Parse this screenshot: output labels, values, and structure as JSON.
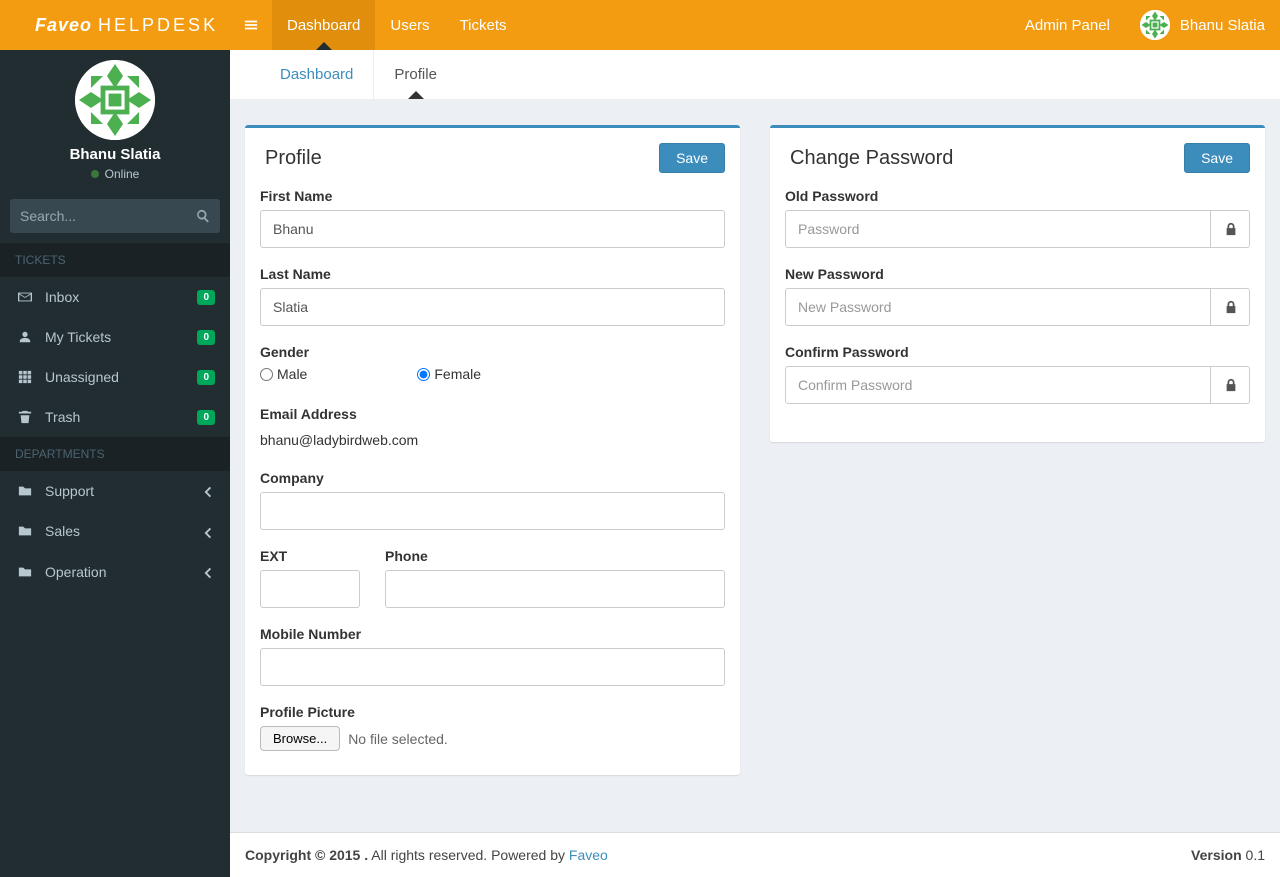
{
  "navbar": {
    "logo_strong": "Faveo",
    "logo_light": "HELPDESK",
    "tabs": [
      {
        "label": "Dashboard",
        "active": true
      },
      {
        "label": "Users",
        "active": false
      },
      {
        "label": "Tickets",
        "active": false
      }
    ],
    "admin_link": "Admin Panel",
    "user_name": "Bhanu Slatia"
  },
  "sidebar": {
    "user": {
      "name": "Bhanu Slatia",
      "status": "Online"
    },
    "search_placeholder": "Search...",
    "section_tickets": "TICKETS",
    "section_departments": "DEPARTMENTS",
    "tickets": [
      {
        "label": "Inbox",
        "badge": "0",
        "icon": "envelope"
      },
      {
        "label": "My Tickets",
        "badge": "0",
        "icon": "user"
      },
      {
        "label": "Unassigned",
        "badge": "0",
        "icon": "grid"
      },
      {
        "label": "Trash",
        "badge": "0",
        "icon": "trash"
      }
    ],
    "departments": [
      {
        "label": "Support"
      },
      {
        "label": "Sales"
      },
      {
        "label": "Operation"
      }
    ]
  },
  "content_tabs": [
    {
      "label": "Dashboard",
      "active": false
    },
    {
      "label": "Profile",
      "active": true
    }
  ],
  "profile": {
    "title": "Profile",
    "save": "Save",
    "labels": {
      "first_name": "First Name",
      "last_name": "Last Name",
      "gender": "Gender",
      "male": "Male",
      "female": "Female",
      "email": "Email Address",
      "company": "Company",
      "ext": "EXT",
      "phone": "Phone",
      "mobile": "Mobile Number",
      "profile_picture": "Profile Picture"
    },
    "values": {
      "first_name": "Bhanu",
      "last_name": "Slatia",
      "gender": "Female",
      "email": "bhanu@ladybirdweb.com",
      "company": "",
      "ext": "",
      "phone": "",
      "mobile": ""
    },
    "browse": "Browse...",
    "no_file": "No file selected."
  },
  "password": {
    "title": "Change Password",
    "save": "Save",
    "labels": {
      "old": "Old Password",
      "new": "New Password",
      "confirm": "Confirm Password"
    },
    "placeholders": {
      "old": "Password",
      "new": "New Password",
      "confirm": "Confirm Password"
    }
  },
  "footer": {
    "copyright": "Copyright © 2015 .",
    "rest": " All rights reserved. Powered by ",
    "faveo": "Faveo",
    "version_label": "Version",
    "version": " 0.1"
  }
}
